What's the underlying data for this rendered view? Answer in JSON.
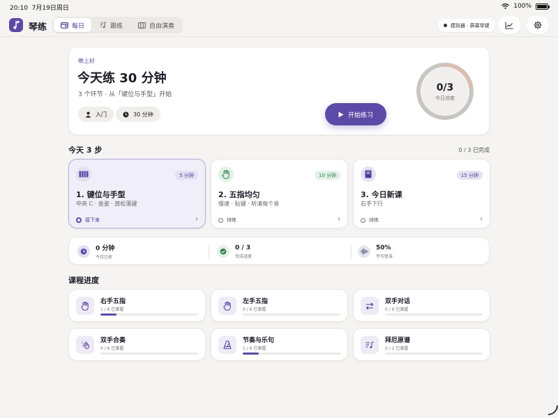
{
  "status_bar": {
    "time": "20:10",
    "date": "7月19日周日",
    "battery": "100%"
  },
  "app": {
    "name": "琴练",
    "accent": "#5b4aa6"
  },
  "tabs": [
    {
      "label": "每日",
      "icon": "calendar-icon",
      "active": true
    },
    {
      "label": "跟练",
      "icon": "music-note-icon",
      "active": false
    },
    {
      "label": "自由演奏",
      "icon": "keyboard-icon",
      "active": false
    }
  ],
  "device_status": "模拟器 · 屏幕琴键",
  "hero": {
    "greeting": "晚上好",
    "title": "今天练 30 分钟",
    "subtitle": "3 个环节 · 从「键位与手型」开始",
    "level_chip": "入门",
    "duration_chip": "30 分钟",
    "start_label": "开始练习",
    "progress_value": "0/3",
    "progress_label": "今日进度",
    "progress_fraction": 0
  },
  "today": {
    "title": "今天 3 步",
    "done": "0 / 3 已完成"
  },
  "steps": [
    {
      "title": "1. 键位与手型",
      "sub": "中央 C · 坐姿 · 放松落键",
      "badge": "5 分钟",
      "status": "接下来",
      "icon": "piano-keys-icon"
    },
    {
      "title": "2. 五指均匀",
      "sub": "慢速 · 贴键 · 听清每个音",
      "badge": "10 分钟",
      "status": "待练",
      "icon": "hand-icon"
    },
    {
      "title": "3. 今日新课",
      "sub": "右手下行",
      "badge": "15 分钟",
      "status": "待练",
      "icon": "book-icon"
    }
  ],
  "stats": [
    {
      "value": "0 分钟",
      "label": "今日已练",
      "icon": "clock-icon"
    },
    {
      "value": "0 / 3",
      "label": "完成进度",
      "icon": "check-icon"
    },
    {
      "value": "50%",
      "label": "平均音准",
      "icon": "waveform-icon"
    }
  ],
  "course": {
    "title": "课程进度",
    "items": [
      {
        "title": "右手五指",
        "sub": "1 / 6 已掌握",
        "progress": 0.167,
        "icon": "hand-icon"
      },
      {
        "title": "左手五指",
        "sub": "0 / 6 已掌握",
        "progress": 0,
        "icon": "hand-icon"
      },
      {
        "title": "双手对话",
        "sub": "0 / 6 已掌握",
        "progress": 0,
        "icon": "swap-arrows-icon"
      },
      {
        "title": "双手合奏",
        "sub": "0 / 6 已掌握",
        "progress": 0,
        "icon": "clapping-hands-icon"
      },
      {
        "title": "节奏与乐句",
        "sub": "1 / 6 已掌握",
        "progress": 0.167,
        "icon": "metronome-icon"
      },
      {
        "title": "拜厄原谱",
        "sub": "0 / 2 已掌握",
        "progress": 0,
        "icon": "score-icon"
      }
    ]
  }
}
